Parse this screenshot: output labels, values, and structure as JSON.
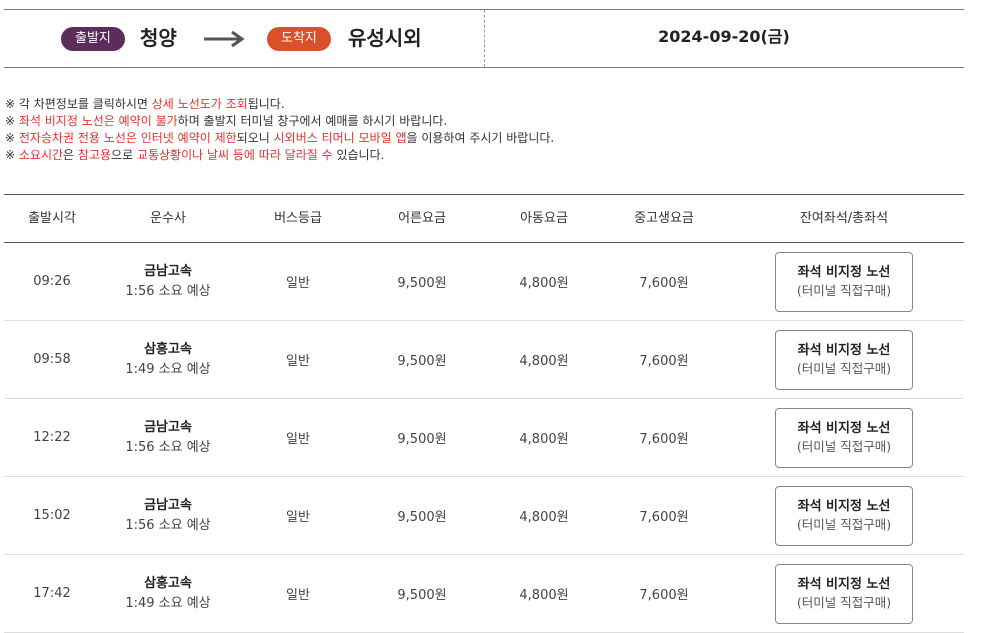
{
  "route": {
    "departure_label": "출발지",
    "departure_city": "청양",
    "arrival_label": "도착지",
    "arrival_city": "유성시외",
    "date": "2024-09-20(금)"
  },
  "notices": [
    [
      {
        "t": "※ 각 차편정보를 클릭하시면 "
      },
      {
        "t": "상세 노선도가 조회",
        "hl": true
      },
      {
        "t": "됩니다."
      }
    ],
    [
      {
        "t": "※ "
      },
      {
        "t": "좌석 비지정 노선은 예약이 불가",
        "hl": true
      },
      {
        "t": "하며 출발지 터미널 창구에서 예매를 하시기 바랍니다."
      }
    ],
    [
      {
        "t": "※ "
      },
      {
        "t": "전자승차권 전용 노선은 인터넷 예약이 제한",
        "hl": true
      },
      {
        "t": "되오니 "
      },
      {
        "t": "시외버스 티머니 모바일 앱",
        "hl": true
      },
      {
        "t": "을 이용하여 주시기 바랍니다."
      }
    ],
    [
      {
        "t": "※ "
      },
      {
        "t": "소요시간",
        "hl": true
      },
      {
        "t": "은 "
      },
      {
        "t": "참고용",
        "hl": true
      },
      {
        "t": "으로 "
      },
      {
        "t": "교통상황이나 날씨 등에 따라 달라질 수",
        "hl": true
      },
      {
        "t": " 있습니다."
      }
    ]
  ],
  "table": {
    "headers": {
      "time": "출발시각",
      "company": "운수사",
      "grade": "버스등급",
      "adult": "어른요금",
      "child": "아동요금",
      "student": "중고생요금",
      "seats": "잔여좌석/총좌석"
    },
    "rows": [
      {
        "time": "09:26",
        "company": "금남고속",
        "duration": "1:56 소요 예상",
        "grade": "일반",
        "adult": "9,500원",
        "child": "4,800원",
        "student": "7,600원",
        "seat_line1": "좌석 비지정 노선",
        "seat_line2": "(터미널 직접구매)"
      },
      {
        "time": "09:58",
        "company": "삼흥고속",
        "duration": "1:49 소요 예상",
        "grade": "일반",
        "adult": "9,500원",
        "child": "4,800원",
        "student": "7,600원",
        "seat_line1": "좌석 비지정 노선",
        "seat_line2": "(터미널 직접구매)"
      },
      {
        "time": "12:22",
        "company": "금남고속",
        "duration": "1:56 소요 예상",
        "grade": "일반",
        "adult": "9,500원",
        "child": "4,800원",
        "student": "7,600원",
        "seat_line1": "좌석 비지정 노선",
        "seat_line2": "(터미널 직접구매)"
      },
      {
        "time": "15:02",
        "company": "금남고속",
        "duration": "1:56 소요 예상",
        "grade": "일반",
        "adult": "9,500원",
        "child": "4,800원",
        "student": "7,600원",
        "seat_line1": "좌석 비지정 노선",
        "seat_line2": "(터미널 직접구매)"
      },
      {
        "time": "17:42",
        "company": "삼흥고속",
        "duration": "1:49 소요 예상",
        "grade": "일반",
        "adult": "9,500원",
        "child": "4,800원",
        "student": "7,600원",
        "seat_line1": "좌석 비지정 노선",
        "seat_line2": "(터미널 직접구매)"
      }
    ]
  },
  "colors": {
    "departure_pill": "#5a2d5b",
    "arrival_pill": "#d9502b",
    "highlight_text": "#e8312f"
  }
}
